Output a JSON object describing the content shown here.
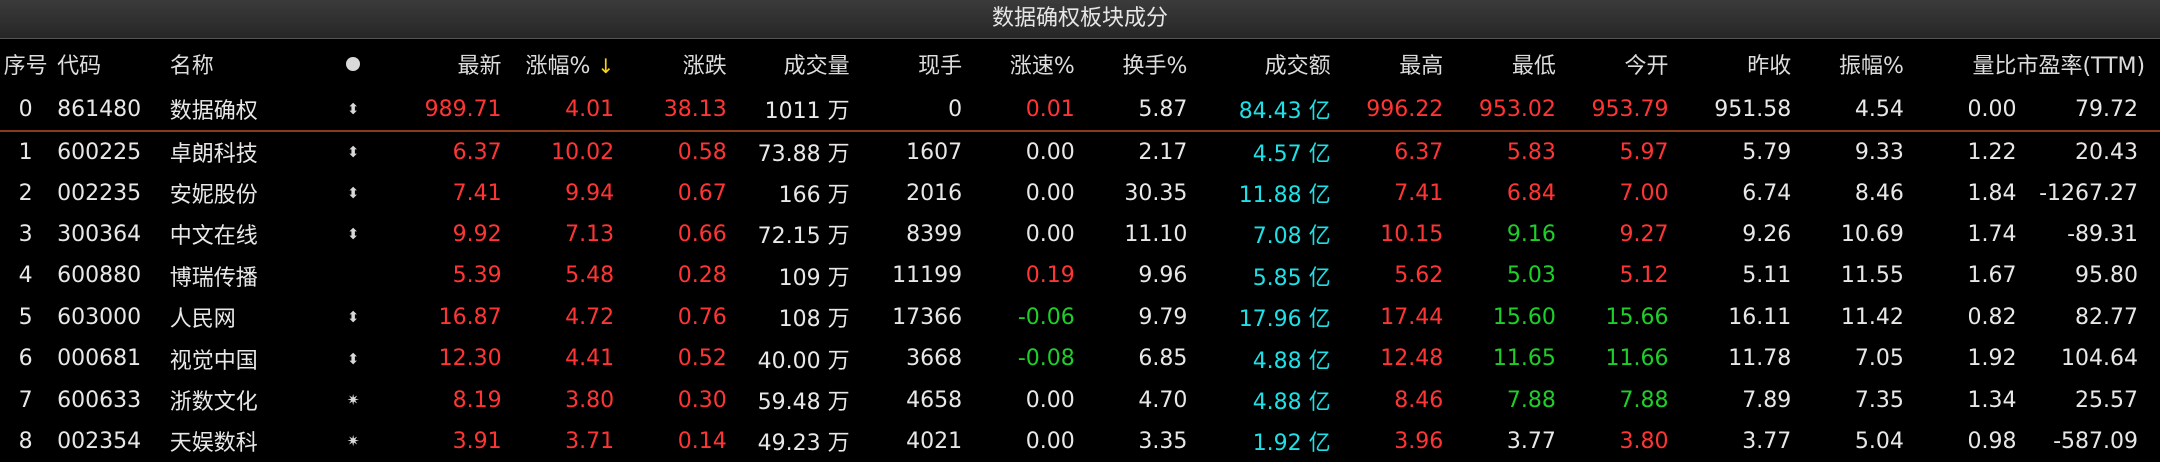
{
  "title": "数据确权板块成分",
  "colors": {
    "up": "#ff3535",
    "down": "#1ecf2a",
    "amount": "#1fe0e6",
    "flat": "#e8e8e8",
    "sort_arrow": "#f6d31a",
    "row_divider": "#8a3a1c"
  },
  "columns": {
    "seq": "序号",
    "code": "代码",
    "name": "名称",
    "flag_icon": "dot-icon",
    "price": "最新",
    "pct": "涨幅%",
    "sort_indicator": "↓",
    "change": "涨跌",
    "volume": "成交量",
    "last_vol": "现手",
    "speed": "涨速%",
    "turnover": "换手%",
    "amount": "成交额",
    "high": "最高",
    "low": "最低",
    "open": "今开",
    "prev_close": "昨收",
    "amplitude": "振幅%",
    "vol_ratio": "量比",
    "pe": "市盈率(TTM)"
  },
  "rows": [
    {
      "seq": "0",
      "code": "861480",
      "name": "数据确权",
      "flag": "⬍",
      "flag_icon": "updown-arrow-icon",
      "price": "989.71",
      "pct": "4.01",
      "change": "38.13",
      "volume": "1011 万",
      "last_vol": "0",
      "speed": "0.01",
      "turnover": "5.87",
      "amount": "84.43 亿",
      "high": "996.22",
      "low": "953.02",
      "open": "953.79",
      "prev_close": "951.58",
      "amplitude": "4.54",
      "vol_ratio": "0.00",
      "pe": "79.72",
      "c": {
        "price": "red",
        "pct": "red",
        "change": "red",
        "speed": "red",
        "high": "red",
        "low": "red",
        "open": "red"
      }
    },
    {
      "seq": "1",
      "code": "600225",
      "name": "卓朗科技",
      "flag": "⬍",
      "flag_icon": "updown-arrow-icon",
      "price": "6.37",
      "pct": "10.02",
      "change": "0.58",
      "volume": "73.88 万",
      "last_vol": "1607",
      "speed": "0.00",
      "turnover": "2.17",
      "amount": "4.57 亿",
      "high": "6.37",
      "low": "5.83",
      "open": "5.97",
      "prev_close": "5.79",
      "amplitude": "9.33",
      "vol_ratio": "1.22",
      "pe": "20.43",
      "c": {
        "price": "red",
        "pct": "red",
        "change": "red",
        "speed": "white",
        "high": "red",
        "low": "red",
        "open": "red"
      }
    },
    {
      "seq": "2",
      "code": "002235",
      "name": "安妮股份",
      "flag": "⬍",
      "flag_icon": "updown-arrow-icon",
      "price": "7.41",
      "pct": "9.94",
      "change": "0.67",
      "volume": "166 万",
      "last_vol": "2016",
      "speed": "0.00",
      "turnover": "30.35",
      "amount": "11.88 亿",
      "high": "7.41",
      "low": "6.84",
      "open": "7.00",
      "prev_close": "6.74",
      "amplitude": "8.46",
      "vol_ratio": "1.84",
      "pe": "-1267.27",
      "c": {
        "price": "red",
        "pct": "red",
        "change": "red",
        "speed": "white",
        "high": "red",
        "low": "red",
        "open": "red"
      }
    },
    {
      "seq": "3",
      "code": "300364",
      "name": "中文在线",
      "flag": "⬍",
      "flag_icon": "updown-arrow-icon",
      "price": "9.92",
      "pct": "7.13",
      "change": "0.66",
      "volume": "72.15 万",
      "last_vol": "8399",
      "speed": "0.00",
      "turnover": "11.10",
      "amount": "7.08 亿",
      "high": "10.15",
      "low": "9.16",
      "open": "9.27",
      "prev_close": "9.26",
      "amplitude": "10.69",
      "vol_ratio": "1.74",
      "pe": "-89.31",
      "c": {
        "price": "red",
        "pct": "red",
        "change": "red",
        "speed": "white",
        "high": "red",
        "low": "green",
        "open": "red"
      }
    },
    {
      "seq": "4",
      "code": "600880",
      "name": "博瑞传播",
      "flag": "",
      "flag_icon": "",
      "price": "5.39",
      "pct": "5.48",
      "change": "0.28",
      "volume": "109 万",
      "last_vol": "11199",
      "speed": "0.19",
      "turnover": "9.96",
      "amount": "5.85 亿",
      "high": "5.62",
      "low": "5.03",
      "open": "5.12",
      "prev_close": "5.11",
      "amplitude": "11.55",
      "vol_ratio": "1.67",
      "pe": "95.80",
      "c": {
        "price": "red",
        "pct": "red",
        "change": "red",
        "speed": "red",
        "high": "red",
        "low": "green",
        "open": "red"
      }
    },
    {
      "seq": "5",
      "code": "603000",
      "name": "人民网",
      "flag": "⬍",
      "flag_icon": "updown-arrow-icon",
      "price": "16.87",
      "pct": "4.72",
      "change": "0.76",
      "volume": "108 万",
      "last_vol": "17366",
      "speed": "-0.06",
      "turnover": "9.79",
      "amount": "17.96 亿",
      "high": "17.44",
      "low": "15.60",
      "open": "15.66",
      "prev_close": "16.11",
      "amplitude": "11.42",
      "vol_ratio": "0.82",
      "pe": "82.77",
      "c": {
        "price": "red",
        "pct": "red",
        "change": "red",
        "speed": "green",
        "high": "red",
        "low": "green",
        "open": "green"
      }
    },
    {
      "seq": "6",
      "code": "000681",
      "name": "视觉中国",
      "flag": "⬍",
      "flag_icon": "updown-arrow-icon",
      "price": "12.30",
      "pct": "4.41",
      "change": "0.52",
      "volume": "40.00 万",
      "last_vol": "3668",
      "speed": "-0.08",
      "turnover": "6.85",
      "amount": "4.88 亿",
      "high": "12.48",
      "low": "11.65",
      "open": "11.66",
      "prev_close": "11.78",
      "amplitude": "7.05",
      "vol_ratio": "1.92",
      "pe": "104.64",
      "c": {
        "price": "red",
        "pct": "red",
        "change": "red",
        "speed": "green",
        "high": "red",
        "low": "green",
        "open": "green"
      }
    },
    {
      "seq": "7",
      "code": "600633",
      "name": "浙数文化",
      "flag": "✷",
      "flag_icon": "star-burst-icon",
      "price": "8.19",
      "pct": "3.80",
      "change": "0.30",
      "volume": "59.48 万",
      "last_vol": "4658",
      "speed": "0.00",
      "turnover": "4.70",
      "amount": "4.88 亿",
      "high": "8.46",
      "low": "7.88",
      "open": "7.88",
      "prev_close": "7.89",
      "amplitude": "7.35",
      "vol_ratio": "1.34",
      "pe": "25.57",
      "c": {
        "price": "red",
        "pct": "red",
        "change": "red",
        "speed": "white",
        "high": "red",
        "low": "green",
        "open": "green"
      }
    },
    {
      "seq": "8",
      "code": "002354",
      "name": "天娱数科",
      "flag": "✷",
      "flag_icon": "star-burst-icon",
      "price": "3.91",
      "pct": "3.71",
      "change": "0.14",
      "volume": "49.23 万",
      "last_vol": "4021",
      "speed": "0.00",
      "turnover": "3.35",
      "amount": "1.92 亿",
      "high": "3.96",
      "low": "3.77",
      "open": "3.80",
      "prev_close": "3.77",
      "amplitude": "5.04",
      "vol_ratio": "0.98",
      "pe": "-587.09",
      "c": {
        "price": "red",
        "pct": "red",
        "change": "red",
        "speed": "white",
        "high": "red",
        "low": "white",
        "open": "red"
      }
    }
  ]
}
